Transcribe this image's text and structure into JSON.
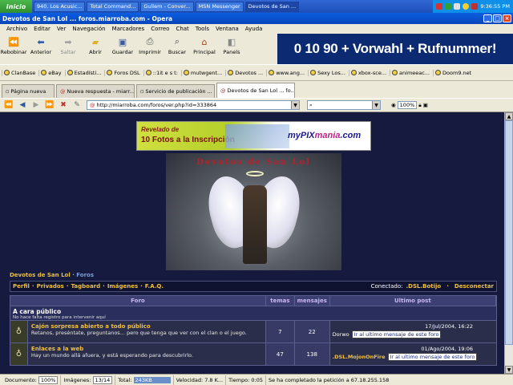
{
  "taskbar": {
    "start_label": "Inicio",
    "tasks": [
      "940. Los Acusic...",
      "Total Command...",
      "Gullem - Conver...",
      "MSN Messenger",
      "Devotos de San ..."
    ],
    "clock": "9:36:55 PM"
  },
  "window": {
    "title": "Devotos de San Lol ... foros.miarroba.com - Opera"
  },
  "menu": [
    "Archivo",
    "Editar",
    "Ver",
    "Navegación",
    "Marcadores",
    "Correo",
    "Chat",
    "Tools",
    "Ventana",
    "Ayuda"
  ],
  "toolbar": {
    "buttons": [
      {
        "label": "Rebobinar",
        "icon": "rewind-icon",
        "enabled": true
      },
      {
        "label": "Anterior",
        "icon": "back-icon",
        "enabled": true
      },
      {
        "label": "Saltar",
        "icon": "forward-icon",
        "enabled": false
      },
      {
        "label": "Abrir",
        "icon": "folder-icon",
        "enabled": true
      },
      {
        "label": "Guardar",
        "icon": "save-icon",
        "enabled": true
      },
      {
        "label": "Imprimir",
        "icon": "print-icon",
        "enabled": true
      },
      {
        "label": "Buscar",
        "icon": "search-icon",
        "enabled": true
      },
      {
        "label": "Principal",
        "icon": "home-icon",
        "enabled": true
      },
      {
        "label": "Panels",
        "icon": "panels-icon",
        "enabled": true
      }
    ]
  },
  "ad_banner": {
    "text": "0 10 90 + Vorwahl + Rufnummer!",
    "bg": "#0b2a72"
  },
  "bookmarks": [
    "ClanBase",
    "eBay",
    "Estadísti...",
    "Foros DSL",
    "::1it e s t:",
    "mutwgent...",
    "Devotos ...",
    "www.ang...",
    "Sexy Los...",
    "xbox-sce...",
    "animeeac...",
    "Doom9.net"
  ],
  "tabs": [
    {
      "label": "Página nueva",
      "active": false
    },
    {
      "label": "Nueva respuesta - miarr...",
      "active": false
    },
    {
      "label": "Servicio de publicación ...",
      "active": false
    },
    {
      "label": "Devotos de San Lol ... fo...",
      "active": true
    }
  ],
  "navigation": {
    "address": "http://miarroba.com/foros/ver.php?id=333864",
    "zoom": "100%"
  },
  "page": {
    "banner": {
      "line1": "Revelado de",
      "line2": "10 Fotos a la Inscripción",
      "logo_a": "myPIX",
      "logo_b": "mania",
      "logo_c": ".com"
    },
    "header_image_title": "Devotos de San Lol",
    "breadcrumb": {
      "site": "Devotos de San Lol",
      "sep": "·",
      "current": "Foros"
    },
    "nav_links": [
      "Perfil",
      "Privados",
      "Tagboard",
      "Imágenes",
      "F.A.Q."
    ],
    "connected_label": "Conectado:",
    "connected_user": ".DSL.Botijo",
    "logout": "Desconectar",
    "columns": [
      "Foro",
      "temas",
      "mensajes",
      "Ultimo post"
    ],
    "category": {
      "name": "A cara público",
      "sub": "No hace falta registro para intervenir aquí"
    },
    "forums": [
      {
        "title": "Cajón sorpresa abierto a todo público",
        "desc": "Retanos, preséntate, preguntanos... pero que tenga que ver con el clan o el juego.",
        "topics": "7",
        "messages": "22",
        "last_date": "17/Jul/2004, 16:22",
        "last_user": "Dorwo",
        "last_link": "Ir al ultimo mensaje de este foro"
      },
      {
        "title": "Enlaces a la web",
        "desc": "Hay un mundo allá afuera, y está esperando para descubrirlo.",
        "topics": "47",
        "messages": "138",
        "last_date": "01/Ago/2004, 19:06",
        "last_user": ".DSL.MojonOnFire",
        "last_link": "Ir al ultimo mensaje de este foro"
      }
    ]
  },
  "status": {
    "documento_label": "Documento:",
    "documento": "100%",
    "imagenes_label": "Imágenes:",
    "imagenes": "13/14",
    "total_label": "Total:",
    "total": "243KB",
    "velocidad_label": "Velocidad:",
    "velocidad": "7.8 K...",
    "tiempo_label": "Tiempo:",
    "tiempo": "0:05",
    "message": "Se ha completado la petición a 67.18.255.158"
  }
}
